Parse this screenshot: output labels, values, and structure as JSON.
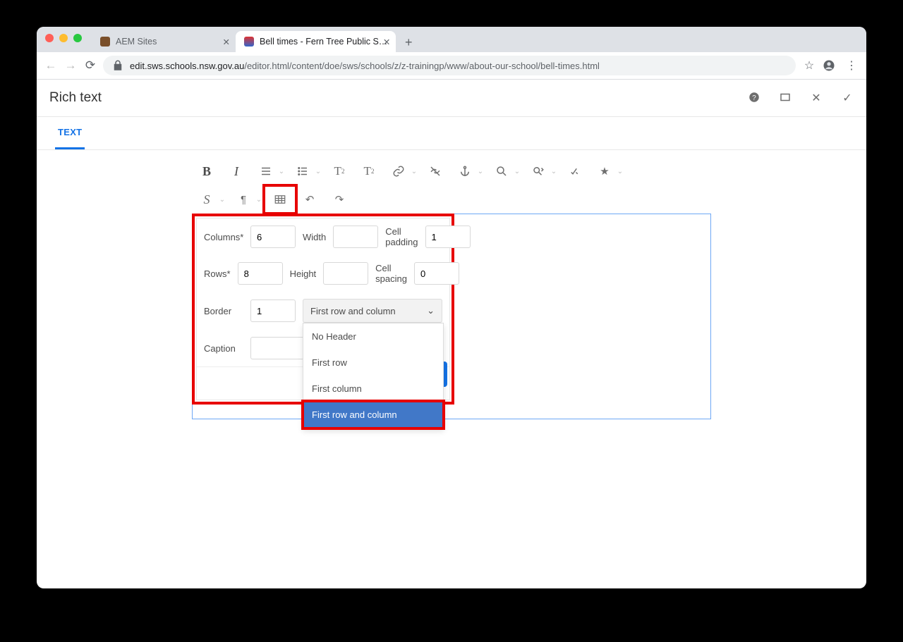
{
  "browser": {
    "tabs": [
      {
        "title": "AEM Sites",
        "active": false
      },
      {
        "title": "Bell times - Fern Tree Public S…",
        "active": true
      }
    ],
    "url_host": "edit.sws.schools.nsw.gov.au",
    "url_path": "/editor.html/content/doe/sws/schools/z/z-trainingp/www/about-our-school/bell-times.html"
  },
  "header": {
    "title": "Rich text"
  },
  "apptab": {
    "label": "TEXT"
  },
  "toolbar": {
    "bold": "B",
    "italic": "I"
  },
  "dialog": {
    "columns_label": "Columns*",
    "columns_value": "6",
    "width_label": "Width",
    "width_value": "",
    "cellpadding_label": "Cell padding",
    "cellpadding_value": "1",
    "rows_label": "Rows*",
    "rows_value": "8",
    "height_label": "Height",
    "height_value": "",
    "cellspacing_label": "Cell spacing",
    "cellspacing_value": "0",
    "border_label": "Border",
    "border_value": "1",
    "header_selected": "First row and column",
    "header_options": [
      "No Header",
      "First row",
      "First column",
      "First row and column"
    ],
    "caption_label": "Caption",
    "caption_value": ""
  }
}
